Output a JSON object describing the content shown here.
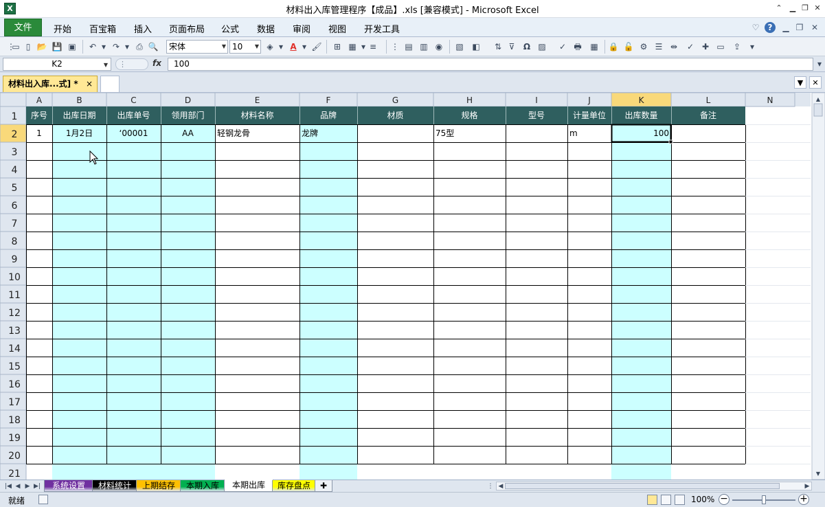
{
  "window": {
    "title": "材料出入库管理程序【成品】.xls  [兼容模式]  -  Microsoft Excel",
    "app_icon_letter": "X"
  },
  "ribbon": {
    "file_tab": "文件",
    "tabs": [
      "开始",
      "百宝箱",
      "插入",
      "页面布局",
      "公式",
      "数据",
      "审阅",
      "视图",
      "开发工具"
    ]
  },
  "toolbar": {
    "font_name": "宋体",
    "font_size": "10",
    "font_color": "#e0302a",
    "fill_color": "#ffff00"
  },
  "formula_bar": {
    "name_box": "K2",
    "fx_label": "fx",
    "formula": "100"
  },
  "workbook_tab": {
    "label": "材料出入库...式] *",
    "close": "×"
  },
  "sheet": {
    "columns": [
      "A",
      "B",
      "C",
      "D",
      "E",
      "F",
      "G",
      "H",
      "I",
      "J",
      "K",
      "L",
      "N"
    ],
    "headers": [
      "序号",
      "出库日期",
      "出库单号",
      "领用部门",
      "材料名称",
      "品牌",
      "材质",
      "规格",
      "型号",
      "计量单位",
      "出库数量",
      "备注"
    ],
    "rows": [
      [
        "1",
        "1月2日",
        "‘00001",
        "AA",
        "轻钢龙骨",
        "龙牌",
        "",
        "75型",
        "",
        "m",
        "100",
        ""
      ]
    ],
    "row_numbers": [
      "1",
      "2",
      "3",
      "4",
      "5",
      "6",
      "7",
      "8",
      "9",
      "10",
      "11",
      "12",
      "13",
      "14",
      "15",
      "16",
      "17",
      "18",
      "19",
      "20",
      "21"
    ],
    "selected_cell": "K2",
    "header_color": "#2f5f5f",
    "shade_color": "#ccffff"
  },
  "sheet_tabs": [
    {
      "label": "系统设置",
      "color": "#7030a0",
      "active": false
    },
    {
      "label": "材料统计",
      "color": "#000000",
      "active": false
    },
    {
      "label": "上期结存",
      "color": "#ffc000",
      "active": false
    },
    {
      "label": "本期入库",
      "color": "#00b050",
      "active": false
    },
    {
      "label": "本期出库",
      "color": "#ffffff",
      "active": true
    },
    {
      "label": "库存盘点",
      "color": "#ffff00",
      "active": false
    }
  ],
  "status": {
    "mode": "就绪",
    "zoom": "100%"
  }
}
